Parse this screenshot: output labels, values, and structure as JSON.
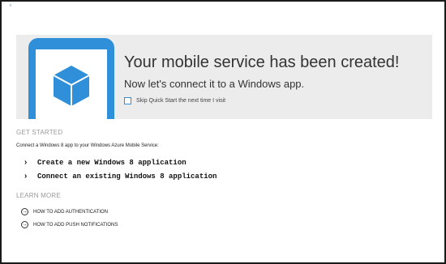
{
  "hero": {
    "title": "Your mobile service has been created!",
    "subtitle": "Now let's connect it to a Windows app.",
    "skip_label": "Skip Quick Start the next time I visit",
    "skip_checked": false,
    "accent_color": "#2f8fd8"
  },
  "get_started": {
    "heading": "GET STARTED",
    "intro": "Connect a Windows 8 app to your Windows Azure Mobile Service:",
    "actions": [
      {
        "label": "Create a new Windows 8 application",
        "icon": "chevron-right-icon"
      },
      {
        "label": "Connect an existing Windows 8 application",
        "icon": "chevron-right-icon"
      }
    ]
  },
  "learn_more": {
    "heading": "LEARN MORE",
    "links": [
      {
        "label": "HOW TO ADD AUTHENTICATION",
        "icon": "circle-arrow-right-icon"
      },
      {
        "label": "HOW TO ADD PUSH NOTIFICATIONS",
        "icon": "circle-arrow-right-icon"
      }
    ]
  }
}
